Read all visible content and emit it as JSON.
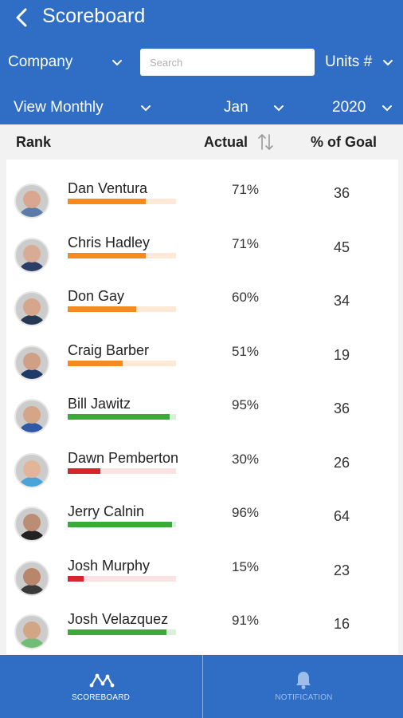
{
  "header": {
    "title": "Scoreboard",
    "back_icon": "chevron-left-icon",
    "filters": {
      "company": "Company",
      "search_placeholder": "Search",
      "units": "Units #",
      "view": "View Monthly",
      "month": "Jan",
      "year": "2020"
    }
  },
  "table": {
    "columns": [
      "Rank",
      "Actual",
      "% of Goal"
    ],
    "sort_icon": "sort-arrows-icon",
    "rows": [
      {
        "name": "Dan Ventura",
        "actual": "71%",
        "goal": "36",
        "progress": 0.72,
        "status": "orange",
        "skin": "#d9a78f",
        "shirt": "#5b7aa8"
      },
      {
        "name": "Chris Hadley",
        "actual": "71%",
        "goal": "45",
        "progress": 0.72,
        "status": "orange",
        "skin": "#d8ac94",
        "shirt": "#2c3e66"
      },
      {
        "name": "Don Gay",
        "actual": "60%",
        "goal": "34",
        "progress": 0.63,
        "status": "orange",
        "skin": "#d5a68b",
        "shirt": "#263852"
      },
      {
        "name": "Craig Barber",
        "actual": "51%",
        "goal": "19",
        "progress": 0.51,
        "status": "orange",
        "skin": "#cfa085",
        "shirt": "#203a68"
      },
      {
        "name": "Bill Jawitz",
        "actual": "95%",
        "goal": "36",
        "progress": 0.94,
        "status": "green",
        "skin": "#d6a487",
        "shirt": "#2f5aa6"
      },
      {
        "name": "Dawn Pemberton",
        "actual": "30%",
        "goal": "26",
        "progress": 0.3,
        "status": "red",
        "skin": "#e2b598",
        "shirt": "#4aa3d9"
      },
      {
        "name": "Jerry Calnin",
        "actual": "96%",
        "goal": "64",
        "progress": 0.96,
        "status": "green",
        "skin": "#bb8d74",
        "shirt": "#222222"
      },
      {
        "name": "Josh Murphy",
        "actual": "15%",
        "goal": "23",
        "progress": 0.15,
        "status": "red",
        "skin": "#b8866b",
        "shirt": "#3a3a3a"
      },
      {
        "name": "Josh Velazquez",
        "actual": "91%",
        "goal": "16",
        "progress": 0.91,
        "status": "green",
        "skin": "#d2a585",
        "shirt": "#6fbd76"
      }
    ]
  },
  "colors": {
    "primary": "#2f6ec4",
    "orange": "#f58b1f",
    "orange_track": "#fde9d6",
    "green": "#3aaa3a",
    "green_track": "#dcefdc",
    "red": "#d7262b",
    "red_track": "#fbe3e3"
  },
  "nav": {
    "items": [
      {
        "label": "SCOREBOARD",
        "icon": "scoreboard-graph-icon",
        "active": true
      },
      {
        "label": "NOTIFICATION",
        "icon": "bell-icon",
        "active": false
      }
    ]
  }
}
